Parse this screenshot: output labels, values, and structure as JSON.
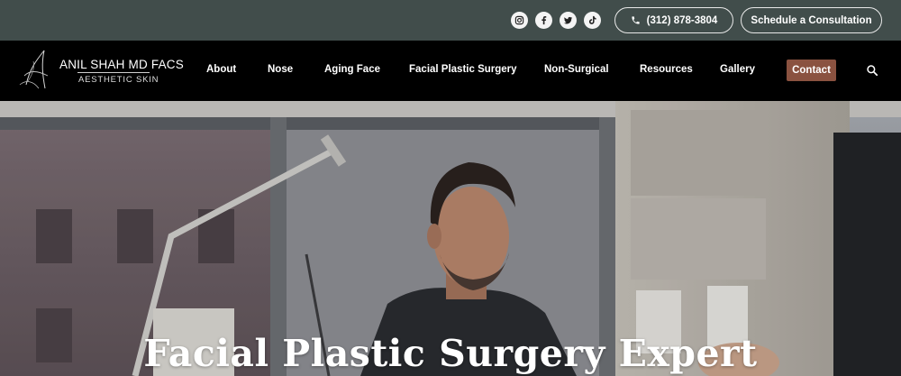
{
  "topbar": {
    "social": [
      {
        "name": "instagram-icon"
      },
      {
        "name": "facebook-icon"
      },
      {
        "name": "twitter-icon"
      },
      {
        "name": "tiktok-icon"
      }
    ],
    "phone_label": "(312) 878-3804",
    "consult_label": "Schedule a Consultation",
    "bg_color": "#414d4b"
  },
  "logo": {
    "name": "ANIL SHAH MD FACS",
    "sub": "AESTHETIC SKIN"
  },
  "nav": {
    "items": [
      "About",
      "Nose",
      "Aging Face",
      "Facial Plastic Surgery",
      "Non-Surgical",
      "Resources",
      "Gallery"
    ],
    "contact_label": "Contact",
    "contact_color": "#8a5240"
  },
  "hero": {
    "title": "Facial Plastic Surgery Expert"
  }
}
